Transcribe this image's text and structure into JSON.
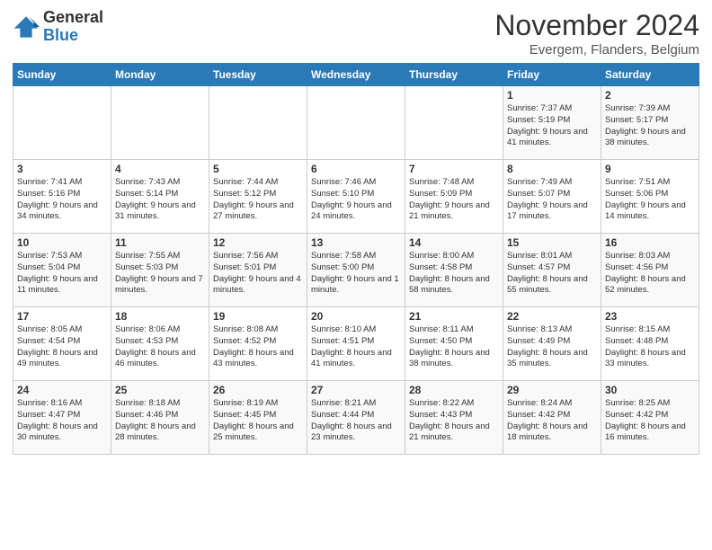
{
  "logo": {
    "general": "General",
    "blue": "Blue"
  },
  "title": "November 2024",
  "subtitle": "Evergem, Flanders, Belgium",
  "days_header": [
    "Sunday",
    "Monday",
    "Tuesday",
    "Wednesday",
    "Thursday",
    "Friday",
    "Saturday"
  ],
  "weeks": [
    [
      {
        "day": "",
        "content": ""
      },
      {
        "day": "",
        "content": ""
      },
      {
        "day": "",
        "content": ""
      },
      {
        "day": "",
        "content": ""
      },
      {
        "day": "",
        "content": ""
      },
      {
        "day": "1",
        "content": "Sunrise: 7:37 AM\nSunset: 5:19 PM\nDaylight: 9 hours and 41 minutes."
      },
      {
        "day": "2",
        "content": "Sunrise: 7:39 AM\nSunset: 5:17 PM\nDaylight: 9 hours and 38 minutes."
      }
    ],
    [
      {
        "day": "3",
        "content": "Sunrise: 7:41 AM\nSunset: 5:16 PM\nDaylight: 9 hours and 34 minutes."
      },
      {
        "day": "4",
        "content": "Sunrise: 7:43 AM\nSunset: 5:14 PM\nDaylight: 9 hours and 31 minutes."
      },
      {
        "day": "5",
        "content": "Sunrise: 7:44 AM\nSunset: 5:12 PM\nDaylight: 9 hours and 27 minutes."
      },
      {
        "day": "6",
        "content": "Sunrise: 7:46 AM\nSunset: 5:10 PM\nDaylight: 9 hours and 24 minutes."
      },
      {
        "day": "7",
        "content": "Sunrise: 7:48 AM\nSunset: 5:09 PM\nDaylight: 9 hours and 21 minutes."
      },
      {
        "day": "8",
        "content": "Sunrise: 7:49 AM\nSunset: 5:07 PM\nDaylight: 9 hours and 17 minutes."
      },
      {
        "day": "9",
        "content": "Sunrise: 7:51 AM\nSunset: 5:06 PM\nDaylight: 9 hours and 14 minutes."
      }
    ],
    [
      {
        "day": "10",
        "content": "Sunrise: 7:53 AM\nSunset: 5:04 PM\nDaylight: 9 hours and 11 minutes."
      },
      {
        "day": "11",
        "content": "Sunrise: 7:55 AM\nSunset: 5:03 PM\nDaylight: 9 hours and 7 minutes."
      },
      {
        "day": "12",
        "content": "Sunrise: 7:56 AM\nSunset: 5:01 PM\nDaylight: 9 hours and 4 minutes."
      },
      {
        "day": "13",
        "content": "Sunrise: 7:58 AM\nSunset: 5:00 PM\nDaylight: 9 hours and 1 minute."
      },
      {
        "day": "14",
        "content": "Sunrise: 8:00 AM\nSunset: 4:58 PM\nDaylight: 8 hours and 58 minutes."
      },
      {
        "day": "15",
        "content": "Sunrise: 8:01 AM\nSunset: 4:57 PM\nDaylight: 8 hours and 55 minutes."
      },
      {
        "day": "16",
        "content": "Sunrise: 8:03 AM\nSunset: 4:56 PM\nDaylight: 8 hours and 52 minutes."
      }
    ],
    [
      {
        "day": "17",
        "content": "Sunrise: 8:05 AM\nSunset: 4:54 PM\nDaylight: 8 hours and 49 minutes."
      },
      {
        "day": "18",
        "content": "Sunrise: 8:06 AM\nSunset: 4:53 PM\nDaylight: 8 hours and 46 minutes."
      },
      {
        "day": "19",
        "content": "Sunrise: 8:08 AM\nSunset: 4:52 PM\nDaylight: 8 hours and 43 minutes."
      },
      {
        "day": "20",
        "content": "Sunrise: 8:10 AM\nSunset: 4:51 PM\nDaylight: 8 hours and 41 minutes."
      },
      {
        "day": "21",
        "content": "Sunrise: 8:11 AM\nSunset: 4:50 PM\nDaylight: 8 hours and 38 minutes."
      },
      {
        "day": "22",
        "content": "Sunrise: 8:13 AM\nSunset: 4:49 PM\nDaylight: 8 hours and 35 minutes."
      },
      {
        "day": "23",
        "content": "Sunrise: 8:15 AM\nSunset: 4:48 PM\nDaylight: 8 hours and 33 minutes."
      }
    ],
    [
      {
        "day": "24",
        "content": "Sunrise: 8:16 AM\nSunset: 4:47 PM\nDaylight: 8 hours and 30 minutes."
      },
      {
        "day": "25",
        "content": "Sunrise: 8:18 AM\nSunset: 4:46 PM\nDaylight: 8 hours and 28 minutes."
      },
      {
        "day": "26",
        "content": "Sunrise: 8:19 AM\nSunset: 4:45 PM\nDaylight: 8 hours and 25 minutes."
      },
      {
        "day": "27",
        "content": "Sunrise: 8:21 AM\nSunset: 4:44 PM\nDaylight: 8 hours and 23 minutes."
      },
      {
        "day": "28",
        "content": "Sunrise: 8:22 AM\nSunset: 4:43 PM\nDaylight: 8 hours and 21 minutes."
      },
      {
        "day": "29",
        "content": "Sunrise: 8:24 AM\nSunset: 4:42 PM\nDaylight: 8 hours and 18 minutes."
      },
      {
        "day": "30",
        "content": "Sunrise: 8:25 AM\nSunset: 4:42 PM\nDaylight: 8 hours and 16 minutes."
      }
    ]
  ]
}
